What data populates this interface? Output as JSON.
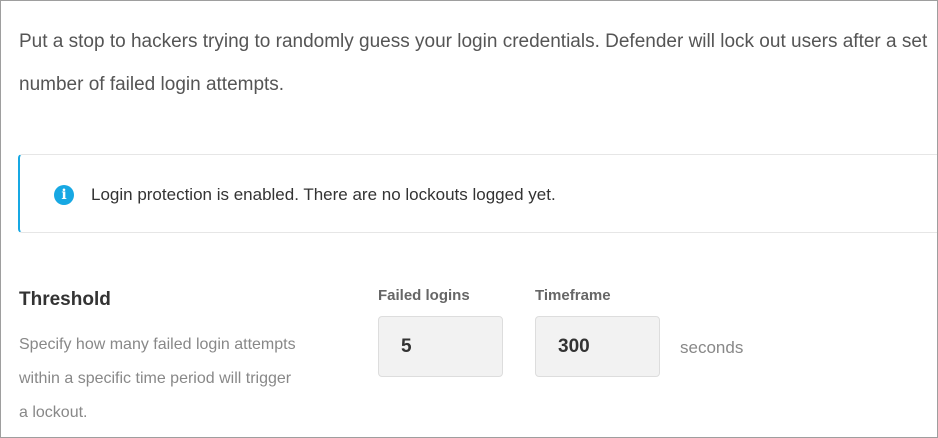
{
  "intro": {
    "text": "Put a stop to hackers trying to randomly guess your login credentials. Defender will lock out users after a set number of failed login attempts."
  },
  "notice": {
    "icon": "info-icon",
    "icon_glyph": "i",
    "color": "#17a8e3",
    "text": "Login protection is enabled. There are no lockouts logged yet."
  },
  "threshold": {
    "title": "Threshold",
    "description": "Specify how many failed login attempts within a specific time period will trigger a lockout.",
    "failed_logins": {
      "label": "Failed logins",
      "value": "5"
    },
    "timeframe": {
      "label": "Timeframe",
      "value": "300",
      "unit": "seconds"
    }
  }
}
